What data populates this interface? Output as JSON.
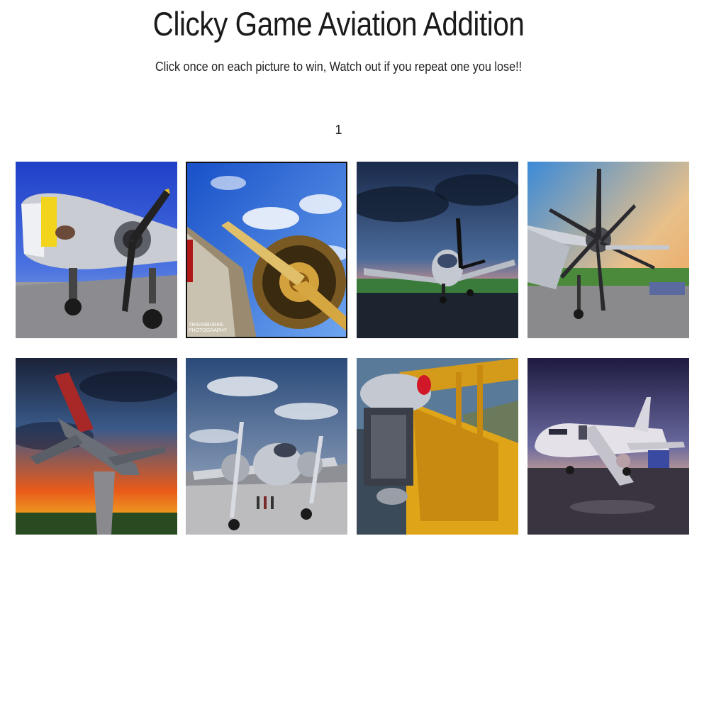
{
  "header": {
    "title": "Clicky Game Aviation Addition",
    "instructions": "Click once on each picture to win, Watch out if you repeat one you lose!!"
  },
  "score": "1",
  "cards": [
    {
      "subject": "b17-bomber-nose-art",
      "icon": "plane-photo-icon"
    },
    {
      "subject": "radial-engine-propeller-closeup",
      "icon": "plane-photo-icon",
      "watermark": "TRAVISBURKE",
      "watermark_sub": "PHOTOGRAPHY"
    },
    {
      "subject": "small-prop-plane-stormy-sky",
      "icon": "plane-photo-icon"
    },
    {
      "subject": "turboprop-sunset-runway",
      "icon": "plane-photo-icon"
    },
    {
      "subject": "jet-on-pedestal-sunset",
      "icon": "plane-photo-icon"
    },
    {
      "subject": "twin-engine-prop-airshow",
      "icon": "plane-photo-icon"
    },
    {
      "subject": "yellow-biplane-engine",
      "icon": "plane-photo-icon"
    },
    {
      "subject": "airliner-boarding-stairs-dusk",
      "icon": "plane-photo-icon"
    }
  ],
  "colors": {
    "background": "#ffffff",
    "text": "#222222"
  }
}
